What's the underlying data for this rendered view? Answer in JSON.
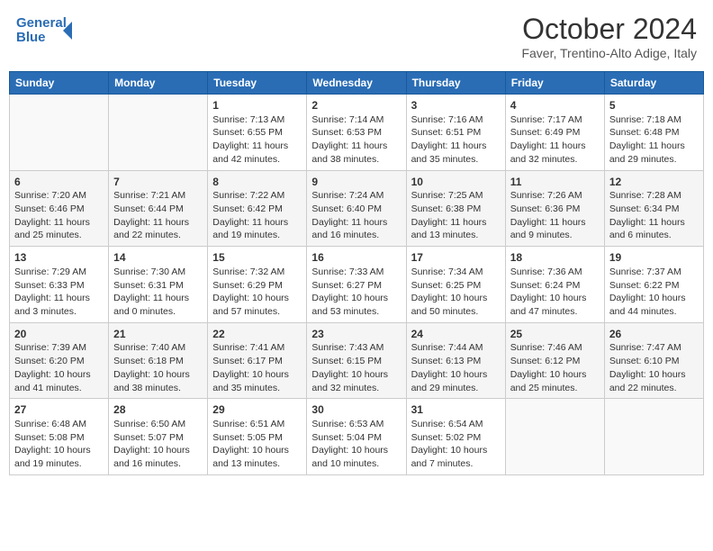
{
  "header": {
    "logo_line1": "General",
    "logo_line2": "Blue",
    "month": "October 2024",
    "location": "Faver, Trentino-Alto Adige, Italy"
  },
  "days_of_week": [
    "Sunday",
    "Monday",
    "Tuesday",
    "Wednesday",
    "Thursday",
    "Friday",
    "Saturday"
  ],
  "weeks": [
    [
      {
        "day": "",
        "info": ""
      },
      {
        "day": "",
        "info": ""
      },
      {
        "day": "1",
        "info": "Sunrise: 7:13 AM\nSunset: 6:55 PM\nDaylight: 11 hours and 42 minutes."
      },
      {
        "day": "2",
        "info": "Sunrise: 7:14 AM\nSunset: 6:53 PM\nDaylight: 11 hours and 38 minutes."
      },
      {
        "day": "3",
        "info": "Sunrise: 7:16 AM\nSunset: 6:51 PM\nDaylight: 11 hours and 35 minutes."
      },
      {
        "day": "4",
        "info": "Sunrise: 7:17 AM\nSunset: 6:49 PM\nDaylight: 11 hours and 32 minutes."
      },
      {
        "day": "5",
        "info": "Sunrise: 7:18 AM\nSunset: 6:48 PM\nDaylight: 11 hours and 29 minutes."
      }
    ],
    [
      {
        "day": "6",
        "info": "Sunrise: 7:20 AM\nSunset: 6:46 PM\nDaylight: 11 hours and 25 minutes."
      },
      {
        "day": "7",
        "info": "Sunrise: 7:21 AM\nSunset: 6:44 PM\nDaylight: 11 hours and 22 minutes."
      },
      {
        "day": "8",
        "info": "Sunrise: 7:22 AM\nSunset: 6:42 PM\nDaylight: 11 hours and 19 minutes."
      },
      {
        "day": "9",
        "info": "Sunrise: 7:24 AM\nSunset: 6:40 PM\nDaylight: 11 hours and 16 minutes."
      },
      {
        "day": "10",
        "info": "Sunrise: 7:25 AM\nSunset: 6:38 PM\nDaylight: 11 hours and 13 minutes."
      },
      {
        "day": "11",
        "info": "Sunrise: 7:26 AM\nSunset: 6:36 PM\nDaylight: 11 hours and 9 minutes."
      },
      {
        "day": "12",
        "info": "Sunrise: 7:28 AM\nSunset: 6:34 PM\nDaylight: 11 hours and 6 minutes."
      }
    ],
    [
      {
        "day": "13",
        "info": "Sunrise: 7:29 AM\nSunset: 6:33 PM\nDaylight: 11 hours and 3 minutes."
      },
      {
        "day": "14",
        "info": "Sunrise: 7:30 AM\nSunset: 6:31 PM\nDaylight: 11 hours and 0 minutes."
      },
      {
        "day": "15",
        "info": "Sunrise: 7:32 AM\nSunset: 6:29 PM\nDaylight: 10 hours and 57 minutes."
      },
      {
        "day": "16",
        "info": "Sunrise: 7:33 AM\nSunset: 6:27 PM\nDaylight: 10 hours and 53 minutes."
      },
      {
        "day": "17",
        "info": "Sunrise: 7:34 AM\nSunset: 6:25 PM\nDaylight: 10 hours and 50 minutes."
      },
      {
        "day": "18",
        "info": "Sunrise: 7:36 AM\nSunset: 6:24 PM\nDaylight: 10 hours and 47 minutes."
      },
      {
        "day": "19",
        "info": "Sunrise: 7:37 AM\nSunset: 6:22 PM\nDaylight: 10 hours and 44 minutes."
      }
    ],
    [
      {
        "day": "20",
        "info": "Sunrise: 7:39 AM\nSunset: 6:20 PM\nDaylight: 10 hours and 41 minutes."
      },
      {
        "day": "21",
        "info": "Sunrise: 7:40 AM\nSunset: 6:18 PM\nDaylight: 10 hours and 38 minutes."
      },
      {
        "day": "22",
        "info": "Sunrise: 7:41 AM\nSunset: 6:17 PM\nDaylight: 10 hours and 35 minutes."
      },
      {
        "day": "23",
        "info": "Sunrise: 7:43 AM\nSunset: 6:15 PM\nDaylight: 10 hours and 32 minutes."
      },
      {
        "day": "24",
        "info": "Sunrise: 7:44 AM\nSunset: 6:13 PM\nDaylight: 10 hours and 29 minutes."
      },
      {
        "day": "25",
        "info": "Sunrise: 7:46 AM\nSunset: 6:12 PM\nDaylight: 10 hours and 25 minutes."
      },
      {
        "day": "26",
        "info": "Sunrise: 7:47 AM\nSunset: 6:10 PM\nDaylight: 10 hours and 22 minutes."
      }
    ],
    [
      {
        "day": "27",
        "info": "Sunrise: 6:48 AM\nSunset: 5:08 PM\nDaylight: 10 hours and 19 minutes."
      },
      {
        "day": "28",
        "info": "Sunrise: 6:50 AM\nSunset: 5:07 PM\nDaylight: 10 hours and 16 minutes."
      },
      {
        "day": "29",
        "info": "Sunrise: 6:51 AM\nSunset: 5:05 PM\nDaylight: 10 hours and 13 minutes."
      },
      {
        "day": "30",
        "info": "Sunrise: 6:53 AM\nSunset: 5:04 PM\nDaylight: 10 hours and 10 minutes."
      },
      {
        "day": "31",
        "info": "Sunrise: 6:54 AM\nSunset: 5:02 PM\nDaylight: 10 hours and 7 minutes."
      },
      {
        "day": "",
        "info": ""
      },
      {
        "day": "",
        "info": ""
      }
    ]
  ]
}
